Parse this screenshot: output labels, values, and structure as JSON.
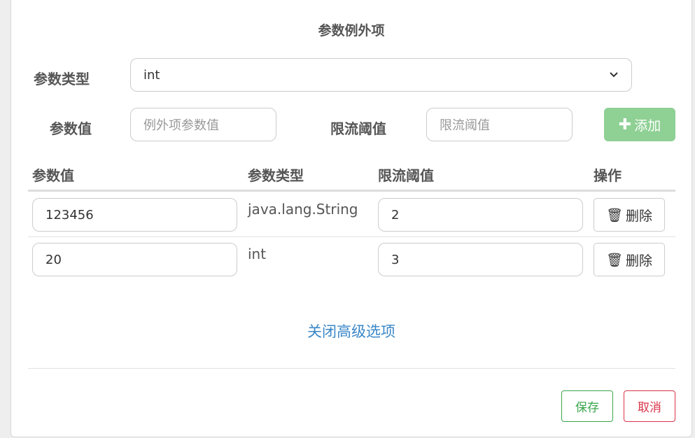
{
  "dialog": {
    "title": "参数例外项"
  },
  "form": {
    "param_type_label": "参数类型",
    "param_type_value": "int",
    "param_value_label": "参数值",
    "param_value_placeholder": "例外项参数值",
    "threshold_label": "限流阈值",
    "threshold_placeholder": "限流阈值",
    "add_label": "添加"
  },
  "table": {
    "headers": [
      "参数值",
      "参数类型",
      "限流阈值",
      "操作"
    ],
    "rows": [
      {
        "value": "123456",
        "type": "java.lang.String",
        "threshold": "2",
        "action": "删除"
      },
      {
        "value": "20",
        "type": "int",
        "threshold": "3",
        "action": "删除"
      }
    ]
  },
  "toggle_advanced": "关闭高级选项",
  "footer": {
    "save": "保存",
    "cancel": "取消"
  },
  "colors": {
    "add": "#8fd094",
    "link": "#3a87c8",
    "save": "#3aa64a",
    "cancel": "#d9344a"
  }
}
